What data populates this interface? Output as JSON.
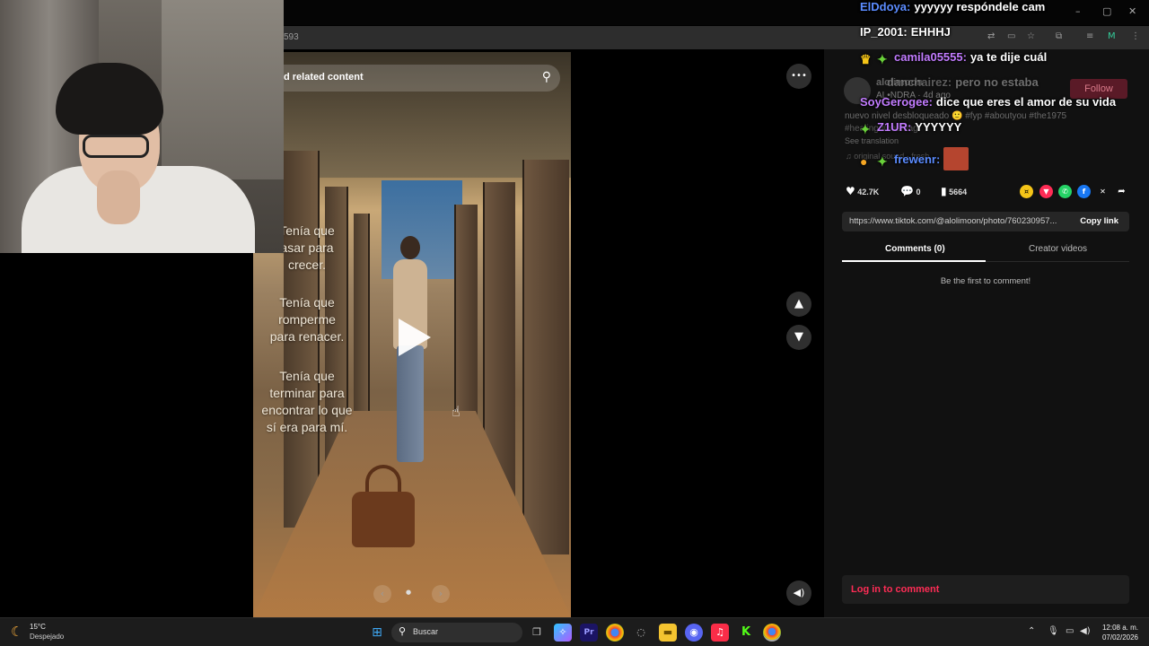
{
  "browser": {
    "address_fragment": "593",
    "window_controls": [
      "–",
      "▢",
      "✕"
    ],
    "toolbar_icons": [
      "translate-icon",
      "cast-icon",
      "bookmark-star-icon",
      "extensions-icon",
      "media-icon",
      "profile-icon",
      "more-icon"
    ]
  },
  "viewer": {
    "search_placeholder": "d related content",
    "overlay_lines": [
      "Tenía que\nasar para\ncrecer.",
      "Tenía que\nromperme\npara renacer.",
      "Tenía que\nterminar para\nencontrar lo que\nsí era para mí."
    ],
    "more_glyph": "•••",
    "up_glyph": "⌃",
    "down_glyph": "⌄",
    "volume_glyph": "🔊",
    "carousel": {
      "prev": "‹",
      "dot": "●",
      "next": "›"
    }
  },
  "chat": {
    "messages": [
      {
        "user": "ElDdoya:",
        "text": "yyyyyy respóndele cam",
        "color": "#5b8cff",
        "badges": []
      },
      {
        "user": "IP_2001:",
        "text": "EHHHJ",
        "color": "#ffffff",
        "badges": []
      },
      {
        "user": "camila05555:",
        "text": "ya te dije cuál",
        "color": "#c27cff",
        "badges": [
          "crown",
          "gem"
        ]
      },
      {
        "user": "danchairez:",
        "text": "pero no estaba",
        "color": "#9a9a9a",
        "badges": []
      },
      {
        "user": "SoyGerogee:",
        "text": "dice que eres el amor de su vida",
        "color": "#c27cff",
        "badges": []
      },
      {
        "user": "Z1UR:",
        "text": "YYYYYY",
        "color": "#c27cff",
        "badges": [
          "gem"
        ]
      },
      {
        "user": "frewenr:",
        "text": "",
        "color": "#5b8cff",
        "badges": [
          "coin",
          "gem"
        ]
      }
    ]
  },
  "panel": {
    "creator_name": "alolimoon",
    "creator_meta": "AL•NDRA · 4d ago",
    "follow_label": "Follow",
    "caption": "nuevo nivel desbloqueado 🙂 #fyp #aboutyou #the1975",
    "caption_2": "#healing #hashtag",
    "see_translation": "See translation",
    "sound": "♫ original sound - fresh",
    "likes": "42.7K",
    "comments_count": "0",
    "saves": "5664",
    "link_url": "https://www.tiktok.com/@alolimoon/photo/760230957...",
    "copy_link": "Copy link",
    "tab_comments": "Comments (0)",
    "tab_creator": "Creator videos",
    "empty_comments": "Be the first to comment!",
    "login_prompt": "Log in to comment",
    "share_icons": [
      "tiktok-coin-icon",
      "repost-icon",
      "whatsapp-icon",
      "facebook-icon",
      "x-icon",
      "share-arrow-icon"
    ]
  },
  "taskbar": {
    "temperature": "15°C",
    "weather": "Despejado",
    "search_label": "Buscar",
    "time": "12:08 a. m.",
    "date": "07/02/2026",
    "apps": [
      "windows-start-icon",
      "task-view-icon",
      "copilot-icon",
      "premiere-icon",
      "chrome-icon",
      "discord-like-icon",
      "file-explorer-icon",
      "discord-icon",
      "music-icon",
      "kick-icon",
      "chrome-profile-icon"
    ]
  },
  "colors": {
    "accent": "#fe2c55",
    "follow_bg": "#5a1a27",
    "panel_bg": "#111111",
    "chat_purple": "#c27cff",
    "chat_blue": "#5b8cff"
  }
}
